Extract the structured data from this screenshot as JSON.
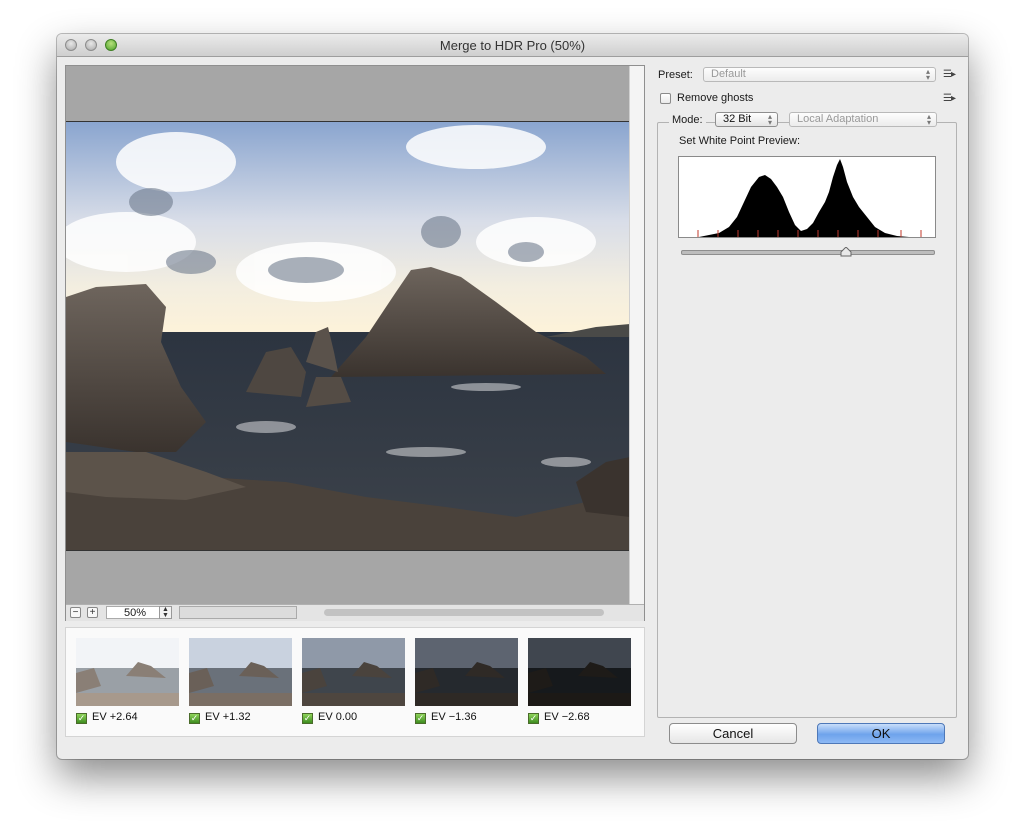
{
  "window": {
    "title": "Merge to HDR Pro (50%)"
  },
  "preview": {
    "zoom_value": "50%",
    "zoom_out": "−",
    "zoom_in": "+"
  },
  "thumbnails": [
    {
      "label": "EV +2.64",
      "checked": true
    },
    {
      "label": "EV +1.32",
      "checked": true
    },
    {
      "label": "EV 0.00",
      "checked": true
    },
    {
      "label": "EV −1.36",
      "checked": true
    },
    {
      "label": "EV −2.68",
      "checked": true
    }
  ],
  "panel": {
    "preset_label": "Preset:",
    "preset_value": "Default",
    "remove_ghosts_label": "Remove ghosts",
    "mode_label": "Mode:",
    "mode_value": "32 Bit",
    "method_value": "Local Adaptation",
    "white_point_label": "Set White Point Preview:"
  },
  "buttons": {
    "cancel": "Cancel",
    "ok": "OK"
  }
}
